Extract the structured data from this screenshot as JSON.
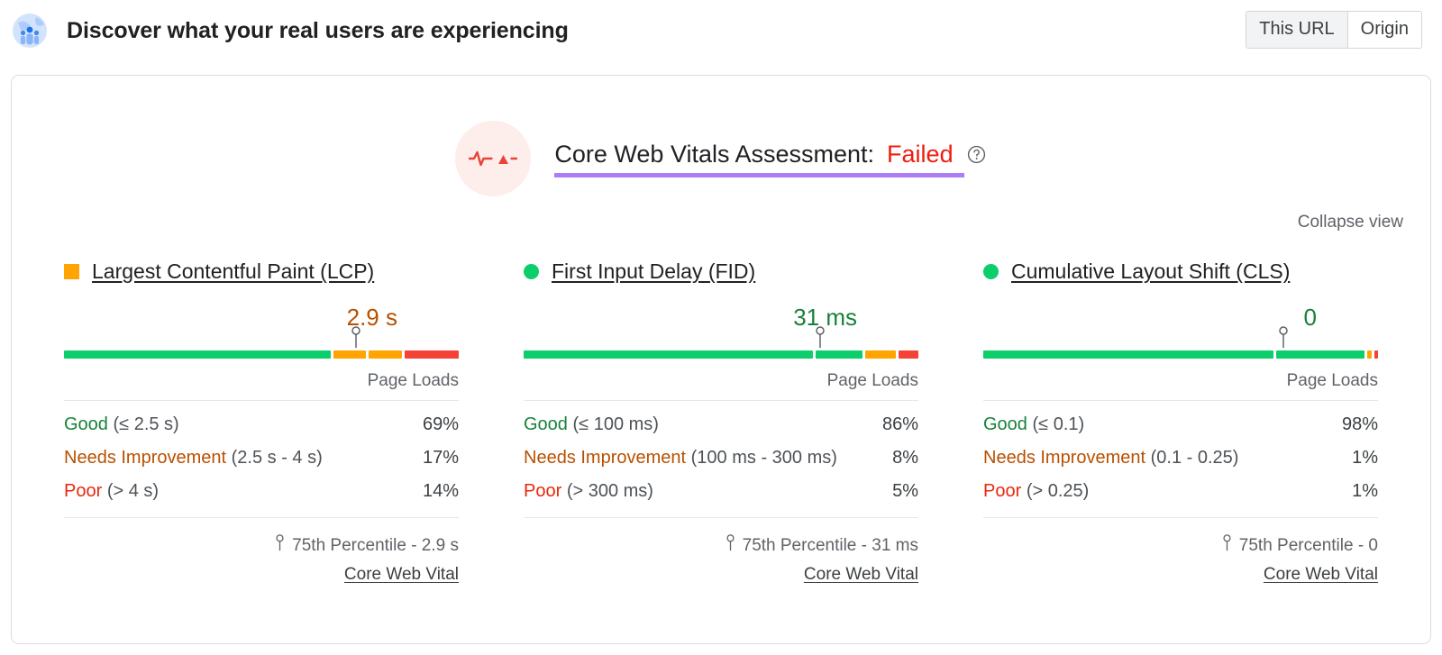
{
  "header": {
    "icon": "users-globe-icon",
    "title": "Discover what your real users are experiencing",
    "scope_toggle": {
      "options": [
        "This URL",
        "Origin"
      ],
      "selected": "This URL"
    }
  },
  "assessment": {
    "icon": "pulse-warning-icon",
    "label": "Core Web Vitals Assessment:",
    "status": "Failed",
    "status_color": "#f01c0e",
    "underline_color": "#ab7df6",
    "help_icon": "help-circle-icon",
    "collapse_label": "Collapse view"
  },
  "colors": {
    "good": "#0cce6b",
    "needs_improvement": "#ffa400",
    "poor": "#f44336",
    "good_text": "#178239",
    "needs_improvement_text": "#b95000",
    "poor_text": "#e8290b"
  },
  "table_header": "Page Loads",
  "chart_data": {
    "type": "bar",
    "title": "Core Web Vitals Assessment: Failed",
    "xlabel": "",
    "ylabel": "Page Loads",
    "categories": [
      "Good",
      "Needs Improvement",
      "Poor"
    ],
    "legend_position": "inline",
    "metrics": [
      {
        "name": "Largest Contentful Paint (LCP)",
        "abbr": "LCP",
        "marker": "square",
        "marker_color": "#ffa400",
        "value": "2.9 s",
        "value_color": "#b95000",
        "percentile_marker_pct": 74,
        "distribution": [
          {
            "bucket": "Good",
            "range": "(≤ 2.5 s)",
            "percent": "69%",
            "value": 69
          },
          {
            "bucket": "Needs Improvement",
            "range": "(2.5 s - 4 s)",
            "percent": "17%",
            "value": 17
          },
          {
            "bucket": "Poor",
            "range": "(> 4 s)",
            "percent": "14%",
            "value": 14
          }
        ],
        "percentile_label": "75th Percentile - 2.9 s",
        "cwv_label": "Core Web Vital"
      },
      {
        "name": "First Input Delay (FID)",
        "abbr": "FID",
        "marker": "circle",
        "marker_color": "#0cce6b",
        "value": "31 ms",
        "value_color": "#178239",
        "percentile_marker_pct": 75,
        "distribution": [
          {
            "bucket": "Good",
            "range": "(≤ 100 ms)",
            "percent": "86%",
            "value": 86
          },
          {
            "bucket": "Needs Improvement",
            "range": "(100 ms - 300 ms)",
            "percent": "8%",
            "value": 8
          },
          {
            "bucket": "Poor",
            "range": "(> 300 ms)",
            "percent": "5%",
            "value": 5
          }
        ],
        "percentile_label": "75th Percentile - 31 ms",
        "cwv_label": "Core Web Vital"
      },
      {
        "name": "Cumulative Layout Shift (CLS)",
        "abbr": "CLS",
        "marker": "circle",
        "marker_color": "#0cce6b",
        "value": "0",
        "value_color": "#178239",
        "percentile_marker_pct": 76,
        "distribution": [
          {
            "bucket": "Good",
            "range": "(≤ 0.1)",
            "percent": "98%",
            "value": 98
          },
          {
            "bucket": "Needs Improvement",
            "range": "(0.1 - 0.25)",
            "percent": "1%",
            "value": 1
          },
          {
            "bucket": "Poor",
            "range": "(> 0.25)",
            "percent": "1%",
            "value": 1
          }
        ],
        "percentile_label": "75th Percentile - 0",
        "cwv_label": "Core Web Vital"
      }
    ]
  }
}
